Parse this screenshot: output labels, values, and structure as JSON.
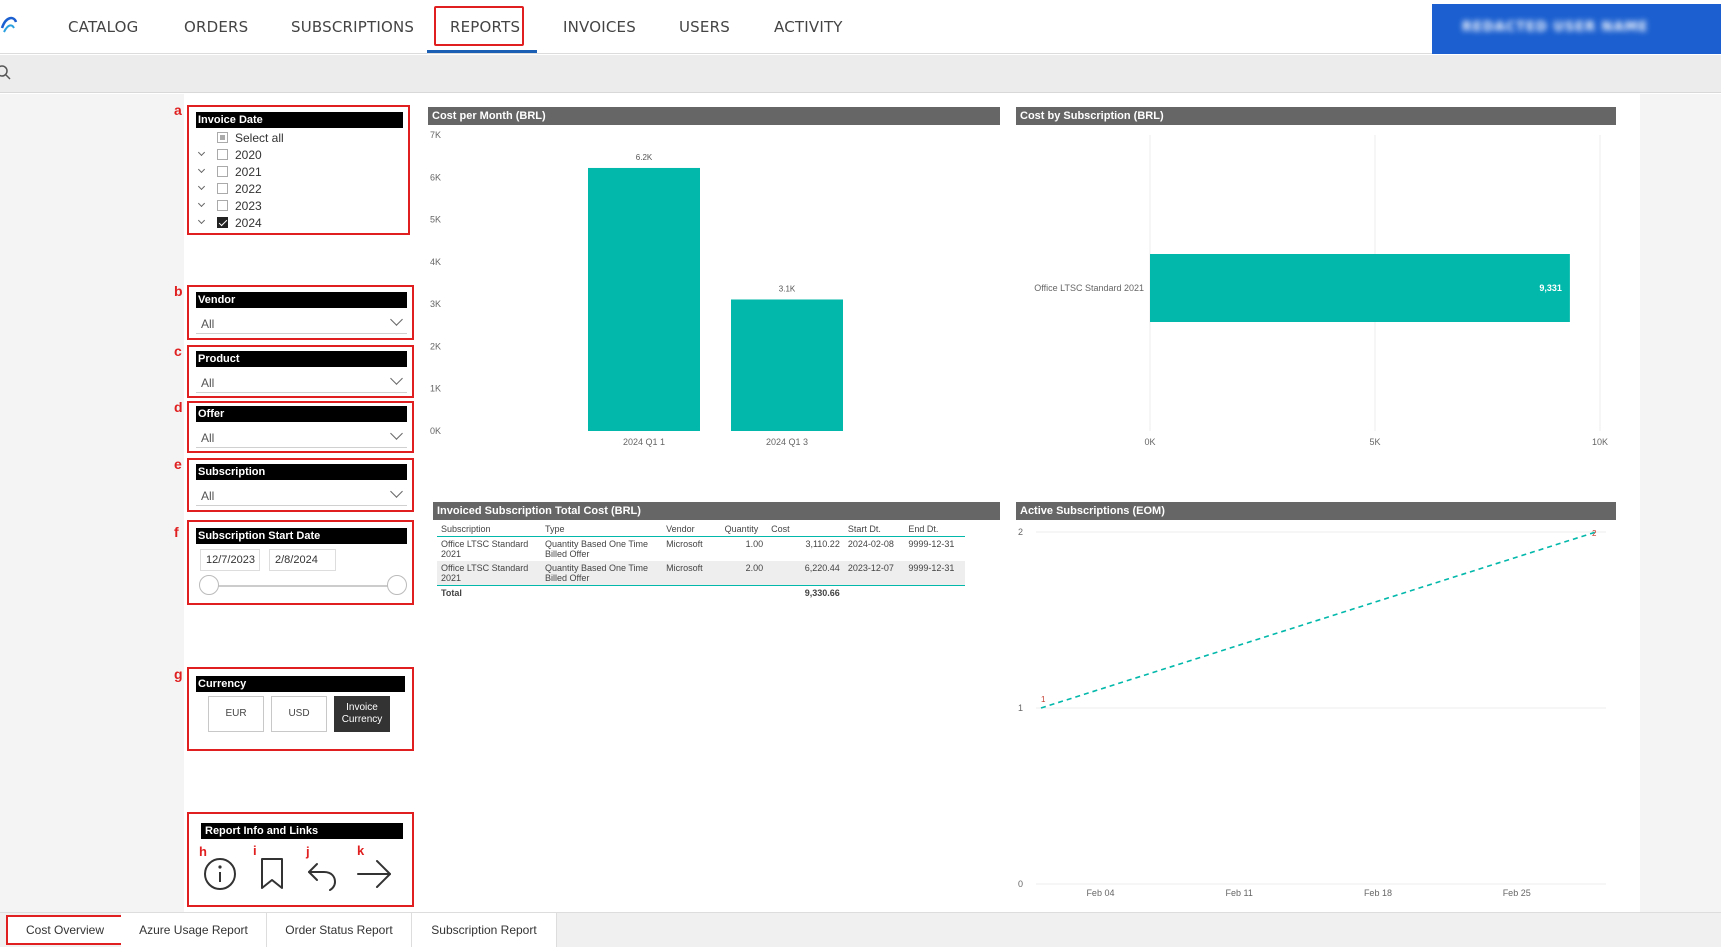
{
  "nav": {
    "tabs": [
      "CATALOG",
      "ORDERS",
      "SUBSCRIPTIONS",
      "REPORTS",
      "INVOICES",
      "USERS",
      "ACTIVITY"
    ],
    "active": "REPORTS",
    "user_name": "REDACTED USER NAME",
    "accent": "#1b5fd0"
  },
  "filters": {
    "invoice_date": {
      "letter": "a",
      "title": "Invoice Date",
      "select_all": "Select all",
      "years": [
        "2020",
        "2021",
        "2022",
        "2023",
        "2024"
      ],
      "checked": "2024"
    },
    "vendor": {
      "letter": "b",
      "title": "Vendor",
      "value": "All"
    },
    "product": {
      "letter": "c",
      "title": "Product",
      "value": "All"
    },
    "offer": {
      "letter": "d",
      "title": "Offer",
      "value": "All"
    },
    "subscription": {
      "letter": "e",
      "title": "Subscription",
      "value": "All"
    },
    "start_date": {
      "letter": "f",
      "title": "Subscription Start Date",
      "from": "12/7/2023",
      "to": "2/8/2024"
    },
    "currency": {
      "letter": "g",
      "title": "Currency",
      "options": [
        "EUR",
        "USD",
        "Invoice Currency"
      ],
      "selected": "Invoice Currency"
    },
    "report_info": {
      "title": "Report Info and Links",
      "letters": [
        "h",
        "i",
        "j",
        "k"
      ],
      "icons": [
        "info-icon",
        "bookmark-icon",
        "back-icon",
        "arrow-right-icon"
      ]
    }
  },
  "visuals": {
    "cost_per_month": {
      "title": "Cost per Month (BRL)"
    },
    "cost_by_subscription": {
      "title": "Cost by Subscription (BRL)"
    },
    "invoiced_table": {
      "title": "Invoiced Subscription Total Cost (BRL)"
    },
    "active_subs": {
      "title": "Active Subscriptions (EOM)"
    }
  },
  "chart_data": [
    {
      "type": "bar",
      "title": "Cost per Month (BRL)",
      "categories": [
        "2024 Q1 1",
        "2024 Q1 3"
      ],
      "values": [
        6220.44,
        3110.22
      ],
      "data_labels": [
        "6.2K",
        "3.1K"
      ],
      "y_ticks": [
        "0K",
        "1K",
        "2K",
        "3K",
        "4K",
        "5K",
        "6K",
        "7K"
      ],
      "ylim": [
        0,
        7000
      ],
      "color": "#01b8aa"
    },
    {
      "type": "bar",
      "orientation": "horizontal",
      "title": "Cost by Subscription (BRL)",
      "categories": [
        "Office LTSC Standard 2021"
      ],
      "values": [
        9330.66
      ],
      "data_labels": [
        "9,331"
      ],
      "x_ticks": [
        "0K",
        "5K",
        "10K"
      ],
      "xlim": [
        0,
        10000
      ],
      "color": "#01b8aa"
    },
    {
      "type": "table",
      "title": "Invoiced Subscription Total Cost (BRL)",
      "columns": [
        "Subscription",
        "Type",
        "Vendor",
        "Quantity",
        "Cost",
        "Start Dt.",
        "End Dt."
      ],
      "rows": [
        [
          "Office LTSC Standard 2021",
          "Quantity Based One Time Billed Offer",
          "Microsoft",
          "1.00",
          "3,110.22",
          "2024-02-08",
          "9999-12-31"
        ],
        [
          "Office LTSC Standard 2021",
          "Quantity Based One Time Billed Offer",
          "Microsoft",
          "2.00",
          "6,220.44",
          "2023-12-07",
          "9999-12-31"
        ]
      ],
      "total_label": "Total",
      "total_value": "9,330.66"
    },
    {
      "type": "line",
      "title": "Active Subscriptions (EOM)",
      "x_ticks": [
        "Feb 04",
        "Feb 11",
        "Feb 18",
        "Feb 25"
      ],
      "y_ticks": [
        "0",
        "1",
        "2"
      ],
      "ylim": [
        0,
        2
      ],
      "points": [
        {
          "x": "2024-02-01",
          "y": 1
        },
        {
          "x": "2024-02-29",
          "y": 2
        }
      ],
      "point_labels": [
        "1",
        "2"
      ],
      "color": "#01b8aa"
    }
  ],
  "bottom_tabs": [
    "Cost Overview",
    "Azure Usage Report",
    "Order Status Report",
    "Subscription Report"
  ],
  "bottom_active": "Cost Overview"
}
